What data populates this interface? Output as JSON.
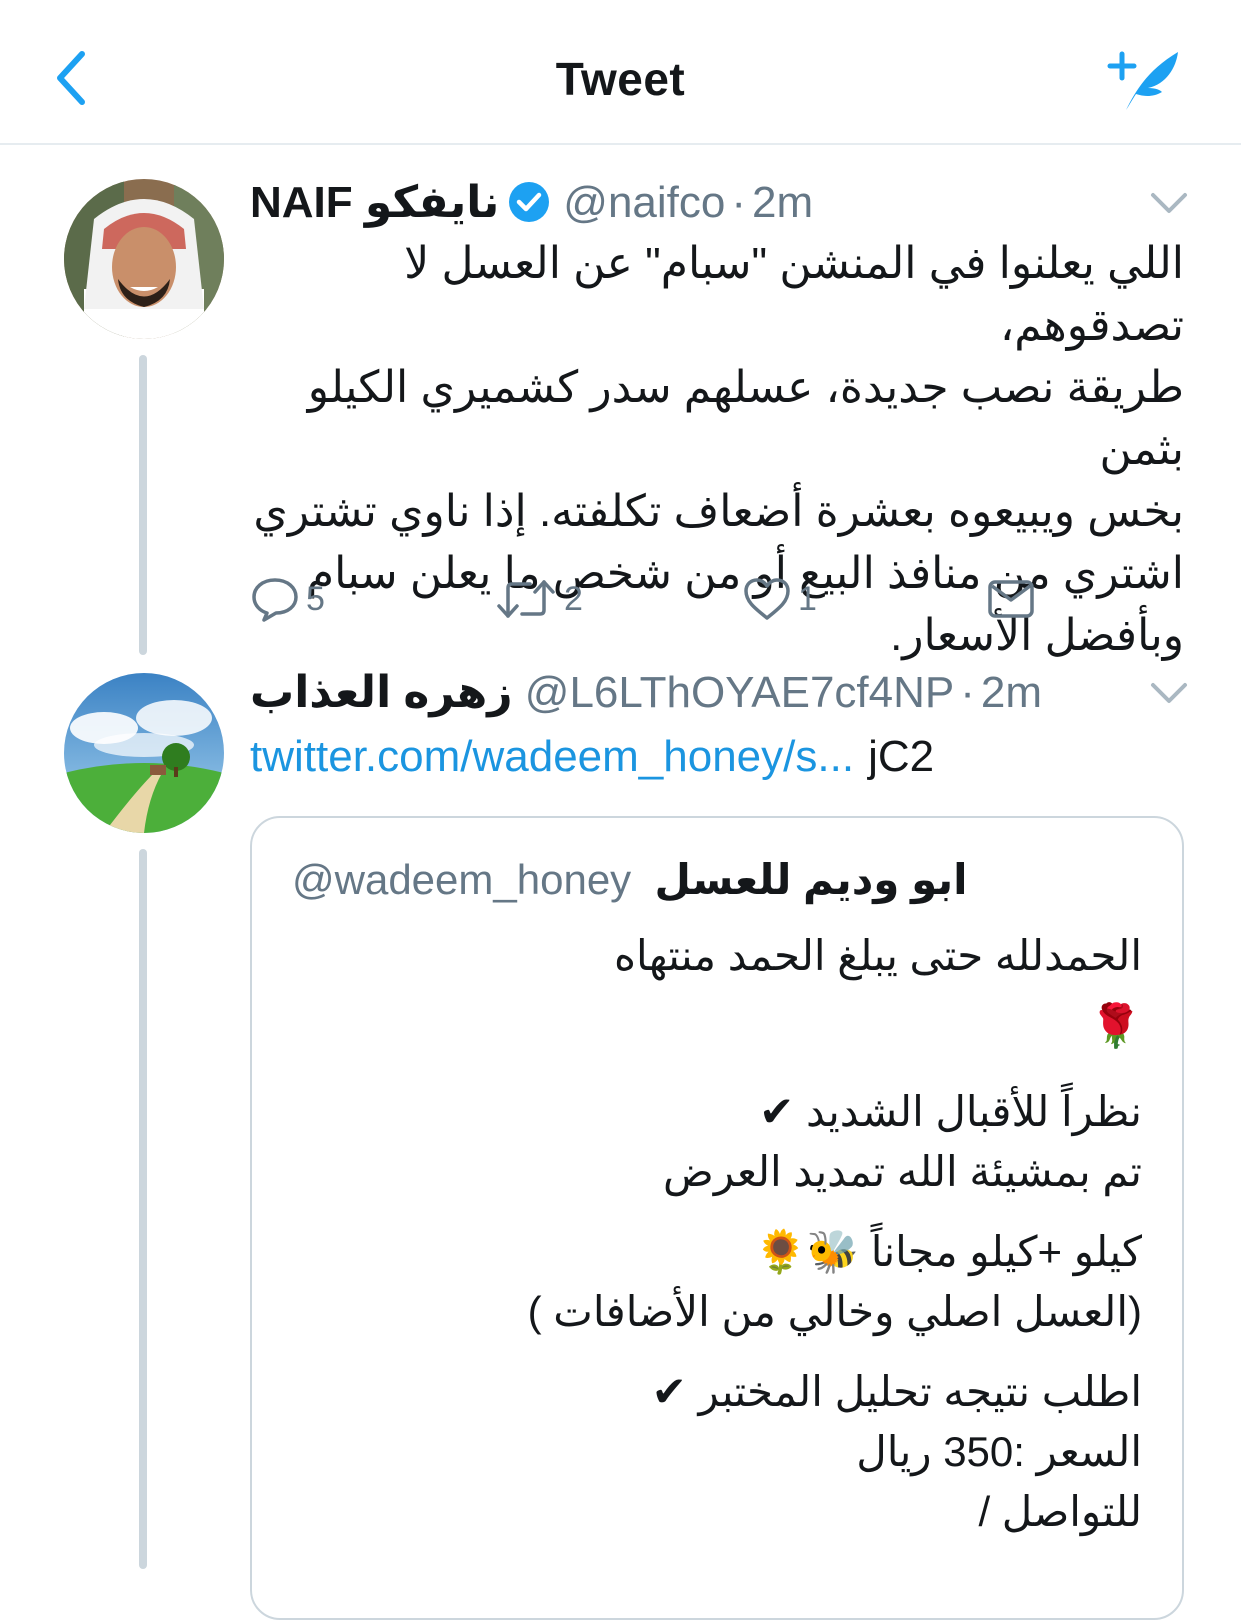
{
  "header": {
    "title": "Tweet",
    "back_icon": "chevron-left-icon",
    "compose_icon": "compose-tweet-icon",
    "accent_color": "#1da1f2"
  },
  "tweets": [
    {
      "display_name": "NAIF نايفكو",
      "handle": "@naifco",
      "separator": "·",
      "time": "2m",
      "verified": true,
      "text_lines": [
        "اللي يعلنوا في المنشن \"سبام\" عن العسل لا تصدقوهم،",
        "طريقة نصب جديدة، عسلهم سدر كشميري الكيلو بثمن",
        "بخس ويبيعوه بعشرة أضعاف تكلفته. إذا ناوي تشتري",
        "اشتري من منافذ البيع أو من شخص ما يعلن سبام",
        "وبأفضل الأسعار."
      ],
      "actions": {
        "reply_count": "5",
        "retweet_count": "2",
        "like_count": "1"
      }
    },
    {
      "display_name": "زهره العذاب",
      "handle": "@L6LThOYAE7cf4NP",
      "separator": "·",
      "time": "2m",
      "link_text": "twitter.com/wadeem_honey/s...",
      "link_suffix": "jC2",
      "quote": {
        "display_name": "ابو وديم للعسل",
        "handle": "@wadeem_honey",
        "lines": [
          "الحمدلله حتى يبلغ الحمد منتهاه",
          "🌹",
          "نظراً للأقبال الشديد ✔",
          "تم بمشيئة الله تمديد العرض",
          "كيلو +كيلو مجاناً 🐝🌻",
          "(العسل اصلي وخالي من الأضافات )",
          "اطلب نتيجه تحليل المختبر ✔",
          "السعر :350 ريال",
          "للتواصل /"
        ]
      }
    }
  ]
}
